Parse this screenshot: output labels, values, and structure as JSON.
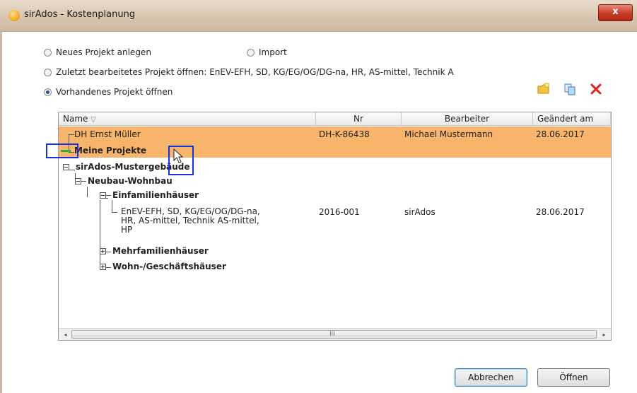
{
  "window": {
    "title": "sirAdos - Kostenplanung",
    "close_glyph": "x"
  },
  "options": {
    "new_project": "Neues Projekt anlegen",
    "import": "Import",
    "last_edited": "Zuletzt bearbeitetes Projekt öffnen: EnEV-EFH, SD, KG/EG/OG/DG-na, HR, AS-mittel, Technik A",
    "open_existing": "Vorhandenes Projekt öffnen",
    "selected": "open_existing"
  },
  "toolbar": {
    "icons": [
      "folder-add-icon",
      "copy-icon",
      "delete-icon"
    ],
    "delete_color": "#e0201b"
  },
  "columns": {
    "name": "Name",
    "sort_glyph": "▽",
    "nr": "Nr",
    "editor": "Bearbeiter",
    "changed": "Geändert am"
  },
  "rows": {
    "r0": {
      "name": "DH Ernst Müller",
      "nr": "DH-K-86438",
      "editor": "Michael Mustermann",
      "changed": "28.06.2017"
    },
    "r1": {
      "name": "Meine Projekte"
    },
    "r2": {
      "name": "sirAdos-Mustergebäude"
    },
    "r3": {
      "name": "Neubau-Wohnbau"
    },
    "r4": {
      "name": "Einfamilienhäuser"
    },
    "r5": {
      "name_l1": "EnEV-EFH, SD, KG/EG/OG/DG-na,",
      "name_l2": "HR, AS-mittel, Technik AS-mittel,",
      "name_l3": "HP",
      "nr": "2016-001",
      "editor": "sirAdos",
      "changed": "28.06.2017"
    },
    "r6": {
      "name": "Mehrfamilienhäuser"
    },
    "r7": {
      "name": "Wohn-/Geschäftshäuser"
    }
  },
  "scrollbar": {
    "left": "◂",
    "right": "▸",
    "grip": "III"
  },
  "buttons": {
    "cancel": "Abbrechen",
    "open": "Öffnen"
  },
  "colors": {
    "selection": "#f7b46a",
    "highlight_box": "#1631e6",
    "accent": "#2a4e9a"
  }
}
